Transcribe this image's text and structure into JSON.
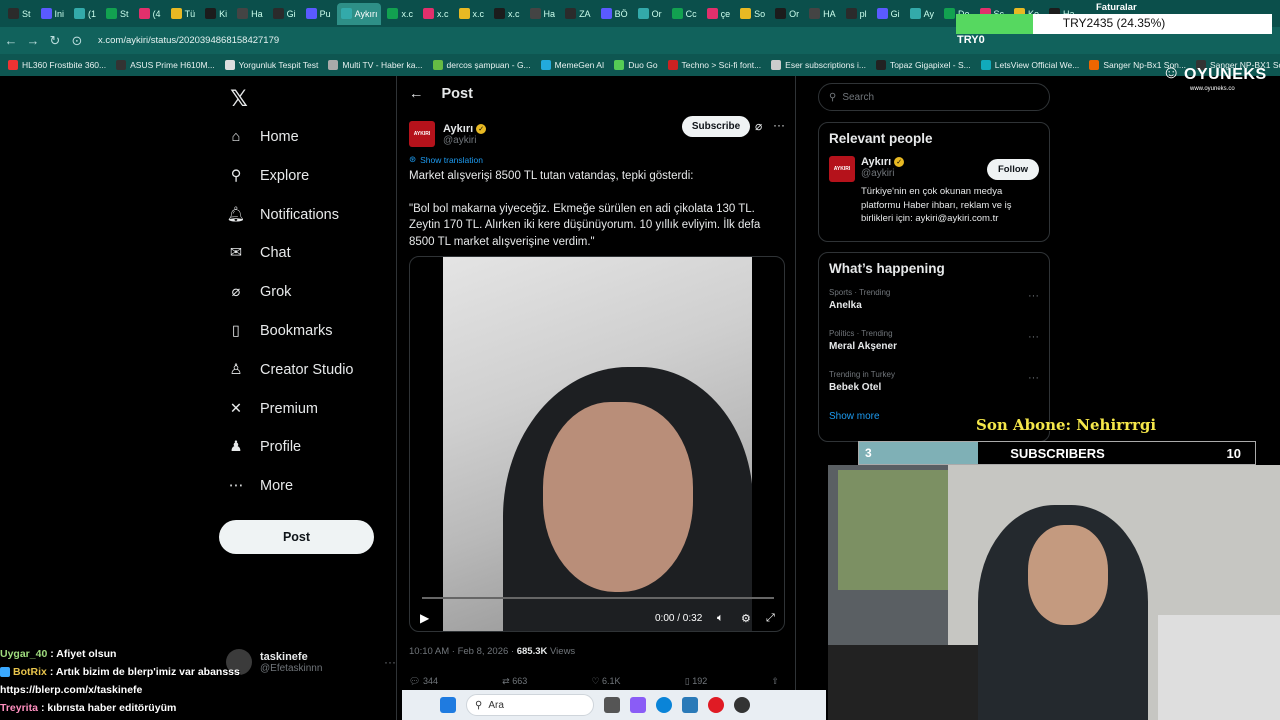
{
  "browser": {
    "tabs": [
      "St",
      "Ini",
      "(1",
      "St",
      "(4",
      "Tü",
      "Ki",
      "Ha",
      "Gi",
      "Pu",
      "Aykırı",
      "x.c",
      "x.c",
      "x.c",
      "x.c",
      "Ha",
      "ZA",
      "BÖ",
      "Or",
      "Cc",
      "çe",
      "So",
      "Or",
      "HA",
      "pl",
      "Gi",
      "Ay",
      "De",
      "Sc",
      "Ke",
      "Ha"
    ],
    "active_tab": "Aykırı",
    "url": "x.com/aykiri/status/2020394868158427179",
    "bookmarks": [
      "HL360 Frostbite 360...",
      "ASUS Prime H610M...",
      "Yorgunluk Tespit Test",
      "Multi TV - Haber ka...",
      "dercos şampuan - G...",
      "MemeGen AI",
      "Duo Go",
      "Techno > Sci-fi font...",
      "Eser subscriptions i...",
      "Topaz Gigapixel - S...",
      "LetsView Official We...",
      "Sanger Np-Bx1 Son...",
      "Sanger NP-BX1 Son..."
    ]
  },
  "leftnav": {
    "items": [
      {
        "label": "Home",
        "icon": "home-icon"
      },
      {
        "label": "Explore",
        "icon": "search-icon"
      },
      {
        "label": "Notifications",
        "icon": "bell-icon"
      },
      {
        "label": "Chat",
        "icon": "mail-icon"
      },
      {
        "label": "Grok",
        "icon": "grok-icon"
      },
      {
        "label": "Bookmarks",
        "icon": "bookmark-icon"
      },
      {
        "label": "Creator Studio",
        "icon": "creator-icon"
      },
      {
        "label": "Premium",
        "icon": "x-icon"
      },
      {
        "label": "Profile",
        "icon": "person-icon"
      },
      {
        "label": "More",
        "icon": "more-icon"
      }
    ],
    "post_button": "Post",
    "account_name": "taskinefe",
    "account_handle": "@Efetaskinnn"
  },
  "post": {
    "header": "Post",
    "author_name": "Aykırı",
    "author_handle": "@aykiri",
    "avatar_text": "AYKIRI",
    "subscribe": "Subscribe",
    "translate": "Show translation",
    "text_line1": "Market alışverişi 8500 TL tutan vatandaş, tepki gösterdi:",
    "text_quote": "\"Bol bol makarna yiyeceğiz. Ekmeğe sürülen en adi çikolata 130 TL. Zeytin 170 TL. Alırken iki kere düşünüyorum. 10 yıllık evliyim. İlk defa 8500 TL market alışverişine verdim.\"",
    "video_time": "0:00 / 0:32",
    "timestamp": "10:10 AM · Feb 8, 2026 · ",
    "views_count": "685.3K",
    "views_label": " Views",
    "actions": [
      "344",
      "663",
      "6.1K",
      "192",
      ""
    ]
  },
  "right": {
    "search_placeholder": "Search",
    "relevant_title": "Relevant people",
    "person_name": "Aykırı",
    "person_handle": "@aykiri",
    "person_bio": "Türkiye'nin en çok okunan medya platformu Haber ihbarı, reklam ve iş birlikleri için: aykiri@aykiri.com.tr",
    "follow": "Follow",
    "happening_title": "What’s happening",
    "trends": [
      {
        "category": "Sports · Trending",
        "name": "Anelka"
      },
      {
        "category": "Politics · Trending",
        "name": "Meral Akşener"
      },
      {
        "category": "Trending in Turkey",
        "name": "Bebek Otel"
      }
    ],
    "show_more": "Show more"
  },
  "overlay": {
    "faturalar": "Faturalar",
    "currency_label": "TRY2435 (24.35%)",
    "currency_progress": 0.2435,
    "try0": "TRY0",
    "oyuneks_brand": "OYUNEKS",
    "oyuneks_site": "www.oyuneks.co",
    "son_abone": "Son Abone: Nehirrrgi",
    "sub_current": "3",
    "sub_label": "SUBSCRIBERS",
    "sub_goal": "10",
    "sub_progress": 0.3
  },
  "chat": [
    {
      "user": "Uygar_40",
      "message": ": Afiyet olsun"
    },
    {
      "user": "BotRix",
      "message": ": Artık bizim de blerp'imiz var abansss"
    },
    {
      "user": "",
      "message": "https://blerp.com/x/taskinefe"
    },
    {
      "user": "Treyrita",
      "message": ": kıbrısta haber editörüyüm"
    }
  ],
  "taskbar": {
    "search_label": "Ara"
  },
  "colors": {
    "accent": "#1d9bf0",
    "browser_tabbar": "#0b4f4b",
    "verified": "#e8b923"
  }
}
